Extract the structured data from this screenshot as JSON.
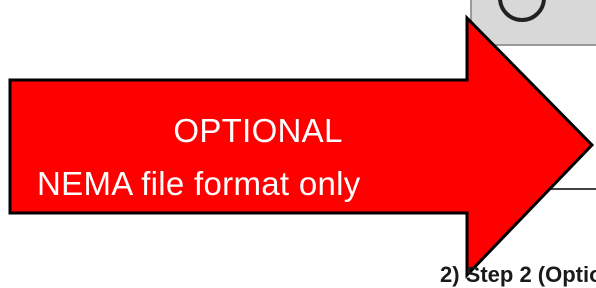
{
  "callout": {
    "line1": "OPTIONAL",
    "line2": "NEMA file format only",
    "fill_color": "#ff0000",
    "stroke_color": "#000000",
    "text_color": "#ffffff"
  },
  "background": {
    "partial_caption": "2)  Step 2 (Optio"
  }
}
